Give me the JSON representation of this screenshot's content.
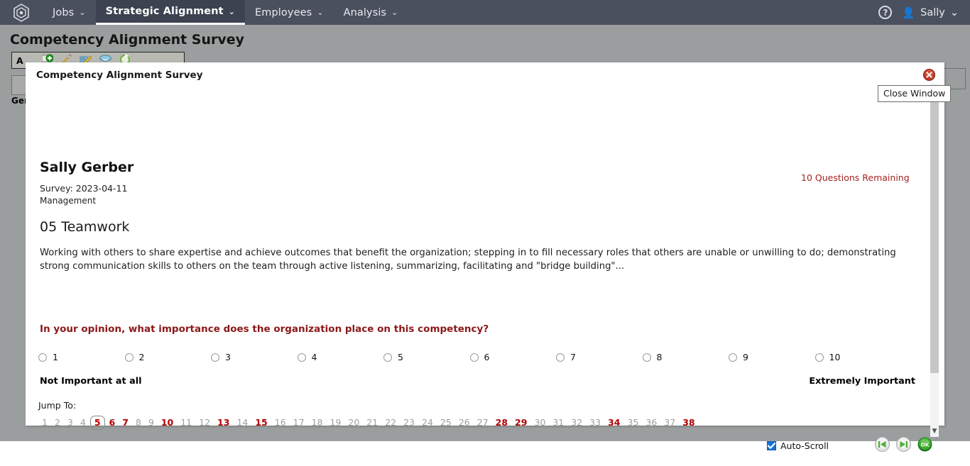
{
  "navbar": {
    "logo_icon": "hexagon-logo-icon",
    "items": [
      {
        "label": "Jobs",
        "caret": "⌄",
        "active": false
      },
      {
        "label": "Strategic Alignment",
        "caret": "⌄",
        "active": true
      },
      {
        "label": "Employees",
        "caret": "⌄",
        "active": false
      },
      {
        "label": "Analysis",
        "caret": "⌄",
        "active": false
      }
    ],
    "help_label": "?",
    "user_name": "Sally",
    "user_caret": "⌄"
  },
  "page": {
    "title": "Competency Alignment Survey",
    "toolbar_label": "A",
    "bg_name": "Ger"
  },
  "modal": {
    "title": "Competency Alignment Survey",
    "close_tooltip": "Close Window",
    "person_name": "Sally Gerber",
    "survey_line": "Survey: 2023-04-11",
    "department": "Management",
    "remaining": "10 Questions Remaining",
    "competency_title": "05 Teamwork",
    "competency_description": "Working with others to share expertise and achieve outcomes that benefit the organization; stepping in to fill necessary roles that others are unable or unwilling to do; demonstrating strong communication skills to others on the team through active listening, summarizing, facilitating and \"bridge building\"...",
    "question": "In your opinion, what importance does the organization place on this competency?",
    "scale_options": [
      "1",
      "2",
      "3",
      "4",
      "5",
      "6",
      "7",
      "8",
      "9",
      "10"
    ],
    "scale_left_label": "Not Important at all",
    "scale_right_label": "Extremely Important",
    "selected_option": null,
    "jump_label": "Jump To:",
    "jump_items": [
      {
        "n": "1",
        "state": "normal"
      },
      {
        "n": "2",
        "state": "normal"
      },
      {
        "n": "3",
        "state": "normal"
      },
      {
        "n": "4",
        "state": "normal"
      },
      {
        "n": "5",
        "state": "current"
      },
      {
        "n": "6",
        "state": "flagged"
      },
      {
        "n": "7",
        "state": "flagged"
      },
      {
        "n": "8",
        "state": "normal"
      },
      {
        "n": "9",
        "state": "normal"
      },
      {
        "n": "10",
        "state": "flagged"
      },
      {
        "n": "11",
        "state": "normal"
      },
      {
        "n": "12",
        "state": "normal"
      },
      {
        "n": "13",
        "state": "flagged"
      },
      {
        "n": "14",
        "state": "normal"
      },
      {
        "n": "15",
        "state": "flagged"
      },
      {
        "n": "16",
        "state": "normal"
      },
      {
        "n": "17",
        "state": "normal"
      },
      {
        "n": "18",
        "state": "normal"
      },
      {
        "n": "19",
        "state": "normal"
      },
      {
        "n": "20",
        "state": "normal"
      },
      {
        "n": "21",
        "state": "normal"
      },
      {
        "n": "22",
        "state": "normal"
      },
      {
        "n": "23",
        "state": "normal"
      },
      {
        "n": "24",
        "state": "normal"
      },
      {
        "n": "25",
        "state": "normal"
      },
      {
        "n": "26",
        "state": "normal"
      },
      {
        "n": "27",
        "state": "normal"
      },
      {
        "n": "28",
        "state": "flagged"
      },
      {
        "n": "29",
        "state": "flagged"
      },
      {
        "n": "30",
        "state": "normal"
      },
      {
        "n": "31",
        "state": "normal"
      },
      {
        "n": "32",
        "state": "normal"
      },
      {
        "n": "33",
        "state": "normal"
      },
      {
        "n": "34",
        "state": "flagged"
      },
      {
        "n": "35",
        "state": "normal"
      },
      {
        "n": "36",
        "state": "normal"
      },
      {
        "n": "37",
        "state": "normal"
      },
      {
        "n": "38",
        "state": "flagged"
      }
    ],
    "autoscroll_label": "Auto-Scroll",
    "autoscroll_checked": true,
    "buttons": [
      {
        "name": "previous-button",
        "icon": "skip-back-icon"
      },
      {
        "name": "next-button",
        "icon": "skip-forward-icon"
      },
      {
        "name": "ok-button",
        "icon": "ok-icon",
        "label": "OK"
      }
    ]
  },
  "colors": {
    "navbar_bg": "#4a505e",
    "page_bg": "#9b9e9e",
    "accent_red": "#b00000",
    "question_red": "#8c1818",
    "remaining_red": "#a52121",
    "ok_green": "#2f9e2f",
    "checkbox_blue": "#1673d6"
  }
}
